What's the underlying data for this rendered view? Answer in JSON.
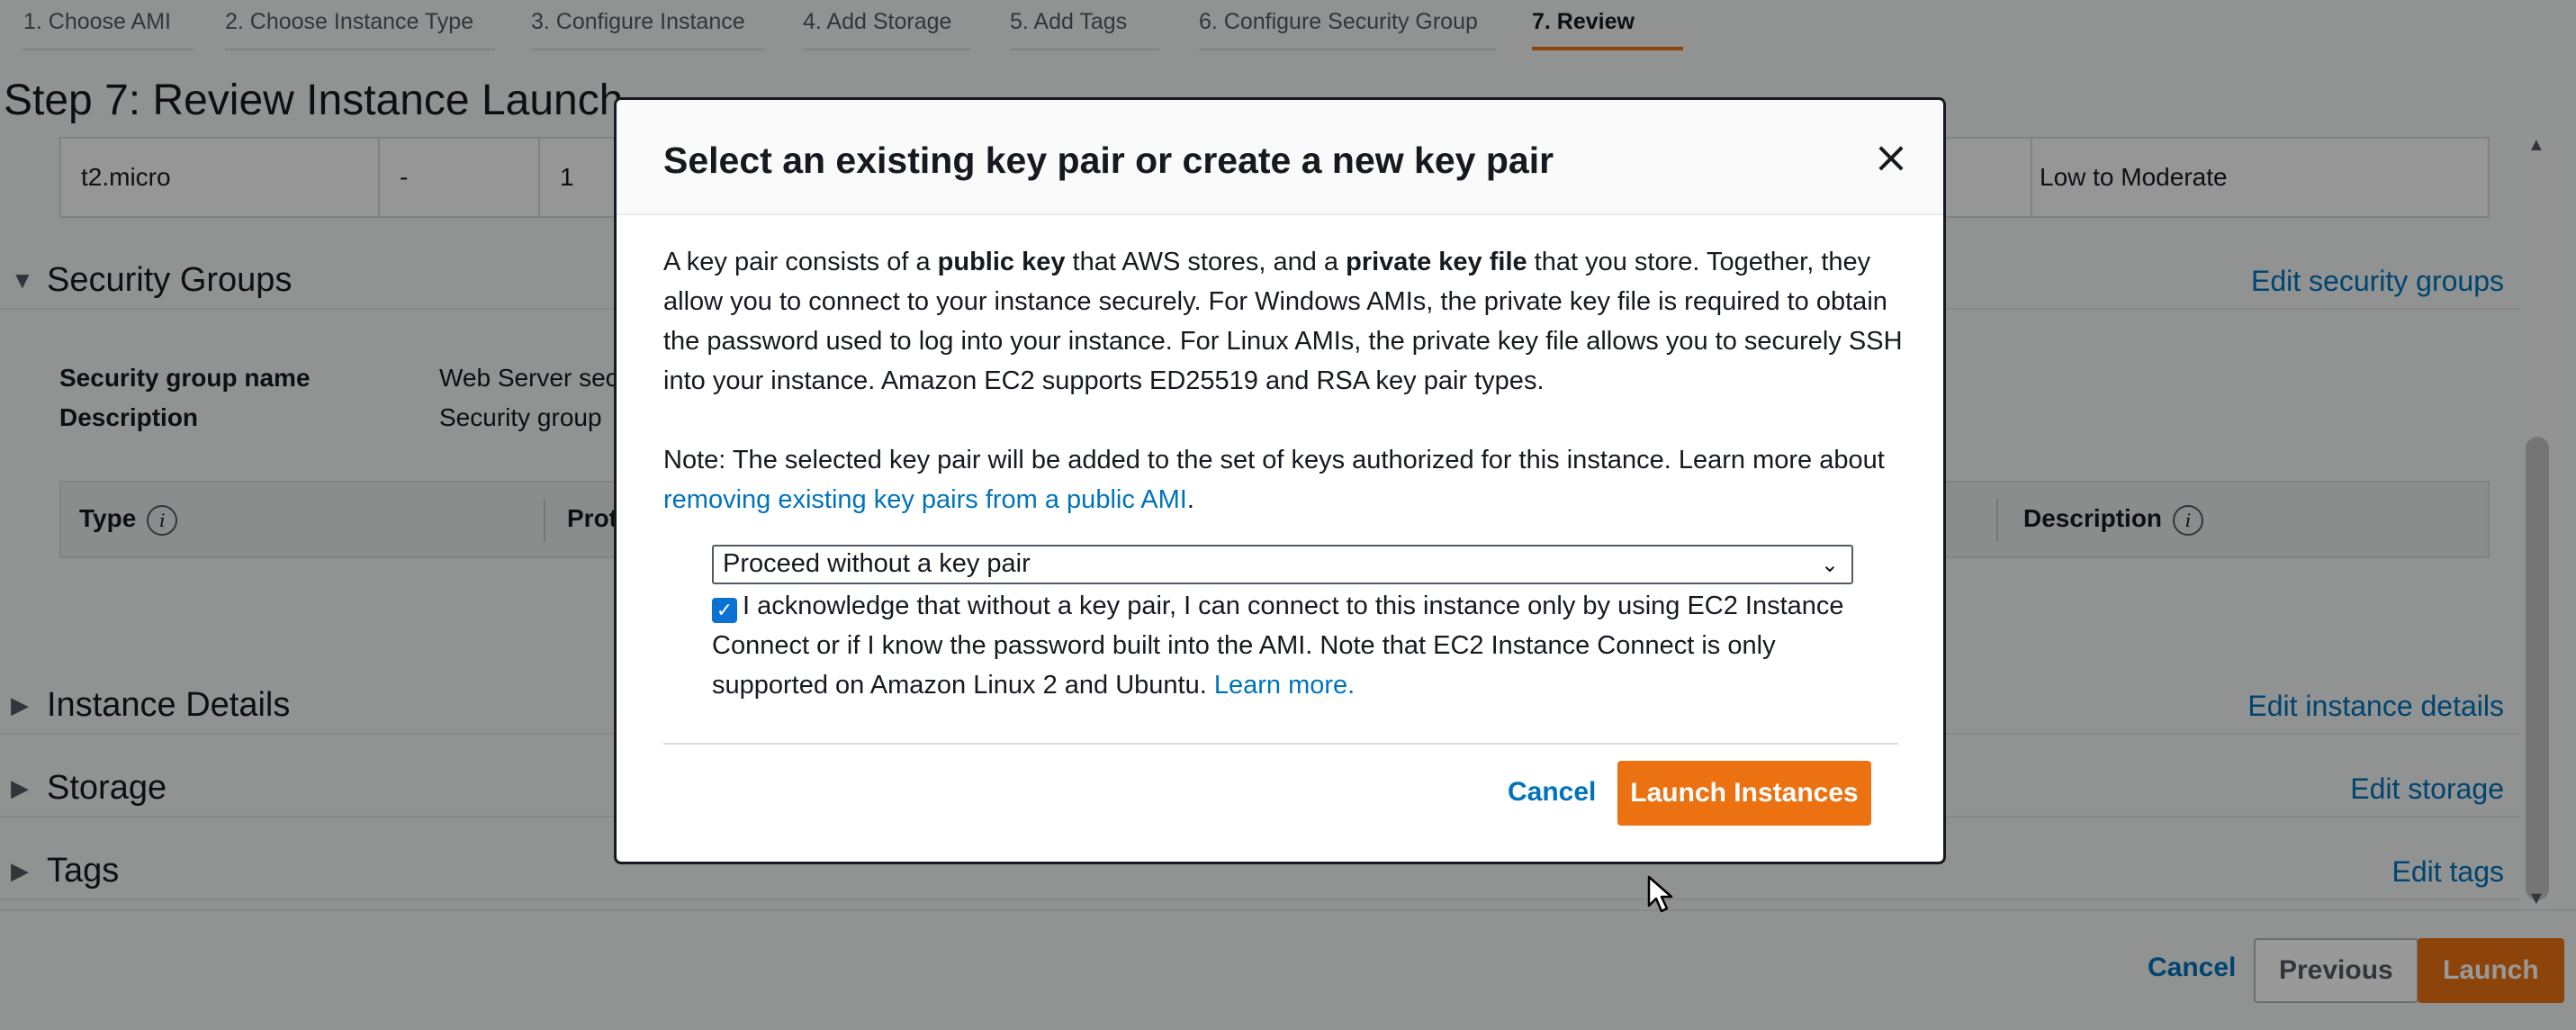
{
  "steps": [
    {
      "label": "1. Choose AMI"
    },
    {
      "label": "2. Choose Instance Type"
    },
    {
      "label": "3. Configure Instance"
    },
    {
      "label": "4. Add Storage"
    },
    {
      "label": "5. Add Tags"
    },
    {
      "label": "6. Configure Security Group"
    },
    {
      "label": "7. Review"
    }
  ],
  "active_step": "7. Review",
  "page_title": "Step 7: Review Instance Launch",
  "instance_row": {
    "type": "t2.micro",
    "ecus": "-",
    "vcpus": "1",
    "network": "Low to Moderate"
  },
  "sections": {
    "security_groups": {
      "title": "Security Groups",
      "edit": "Edit security groups"
    },
    "instance_details": {
      "title": "Instance Details",
      "edit": "Edit instance details"
    },
    "storage": {
      "title": "Storage",
      "edit": "Edit storage"
    },
    "tags": {
      "title": "Tags",
      "edit": "Edit tags"
    }
  },
  "security_group": {
    "name_label": "Security group name",
    "name_value": "Web Server sec",
    "desc_label": "Description",
    "desc_value": "Security group"
  },
  "rules_table": {
    "type": "Type",
    "protocol": "Prot",
    "description": "Description"
  },
  "footer": {
    "cancel": "Cancel",
    "previous": "Previous",
    "launch": "Launch"
  },
  "modal": {
    "title": "Select an existing key pair or create a new key pair",
    "close": "×",
    "intro_1": "A key pair consists of a ",
    "intro_b1": "public key",
    "intro_2": " that AWS stores, and a ",
    "intro_b2": "private key file",
    "intro_3": " that you store. Together, they allow you to connect to your instance securely. For Windows AMIs, the private key file is required to obtain the password used to log into your instance. For Linux AMIs, the private key file allows you to securely SSH into your instance. Amazon EC2 supports ED25519 and RSA key pair types.",
    "note_1": "Note: The selected key pair will be added to the set of keys authorized for this instance. Learn more about ",
    "note_link": "removing existing key pairs from a public AMI",
    "note_2": ".",
    "select_value": "Proceed without a key pair",
    "ack_checked": true,
    "ack_text": "I acknowledge that without a key pair, I can connect to this instance only by using EC2 Instance Connect or if I know the password built into the AMI. Note that EC2 Instance Connect is only supported on Amazon Linux 2 and Ubuntu. ",
    "ack_link": "Learn more.",
    "cancel": "Cancel",
    "launch": "Launch Instances"
  },
  "colors": {
    "accent_orange": "#ec7211",
    "link_blue": "#0073bb",
    "checkbox_blue": "#0972d3",
    "text": "#16191f"
  }
}
